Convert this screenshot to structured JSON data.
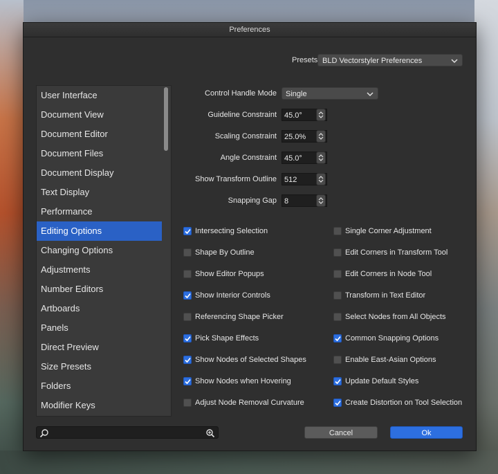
{
  "window": {
    "title": "Preferences"
  },
  "presets": {
    "label": "Presets",
    "value": "BLD Vectorstyler Preferences"
  },
  "sidebar": {
    "items": [
      {
        "label": "User Interface"
      },
      {
        "label": "Document View"
      },
      {
        "label": "Document Editor"
      },
      {
        "label": "Document Files"
      },
      {
        "label": "Document Display"
      },
      {
        "label": "Text Display"
      },
      {
        "label": "Performance"
      },
      {
        "label": "Editing Options"
      },
      {
        "label": "Changing Options"
      },
      {
        "label": "Adjustments"
      },
      {
        "label": "Number Editors"
      },
      {
        "label": "Artboards"
      },
      {
        "label": "Panels"
      },
      {
        "label": "Direct Preview"
      },
      {
        "label": "Size Presets"
      },
      {
        "label": "Folders"
      },
      {
        "label": "Modifier Keys"
      }
    ],
    "selected": "Editing Options"
  },
  "fields": {
    "control_handle_mode": {
      "label": "Control Handle Mode",
      "value": "Single"
    },
    "guideline_constraint": {
      "label": "Guideline Constraint",
      "value": "45.0°"
    },
    "scaling_constraint": {
      "label": "Scaling Constraint",
      "value": "25.0%"
    },
    "angle_constraint": {
      "label": "Angle Constraint",
      "value": "45.0°"
    },
    "show_transform_outline": {
      "label": "Show Transform Outline",
      "value": "512"
    },
    "snapping_gap": {
      "label": "Snapping Gap",
      "value": "8"
    }
  },
  "checkboxes": {
    "left": [
      {
        "label": "Intersecting Selection",
        "checked": true
      },
      {
        "label": "Shape By Outline",
        "checked": false
      },
      {
        "label": "Show Editor Popups",
        "checked": false
      },
      {
        "label": "Show Interior Controls",
        "checked": true
      },
      {
        "label": "Referencing Shape Picker",
        "checked": false
      },
      {
        "label": "Pick Shape Effects",
        "checked": true
      },
      {
        "label": "Show Nodes of Selected Shapes",
        "checked": true
      },
      {
        "label": "Show Nodes when Hovering",
        "checked": true
      },
      {
        "label": "Adjust Node Removal Curvature",
        "checked": false
      }
    ],
    "right": [
      {
        "label": "Single Corner Adjustment",
        "checked": false
      },
      {
        "label": "Edit Corners in Transform Tool",
        "checked": false
      },
      {
        "label": "Edit Corners in Node Tool",
        "checked": false
      },
      {
        "label": "Transform in Text Editor",
        "checked": false
      },
      {
        "label": "Select Nodes from All Objects",
        "checked": false
      },
      {
        "label": "Common Snapping Options",
        "checked": true
      },
      {
        "label": "Enable East-Asian Options",
        "checked": false
      },
      {
        "label": "Update Default Styles",
        "checked": true
      },
      {
        "label": "Create Distortion on Tool Selection",
        "checked": true
      }
    ]
  },
  "search": {
    "value": ""
  },
  "buttons": {
    "cancel": "Cancel",
    "ok": "Ok"
  },
  "colors": {
    "accent": "#2d6fe0",
    "selection": "#2a61c5",
    "panel": "#2f2f2f"
  }
}
